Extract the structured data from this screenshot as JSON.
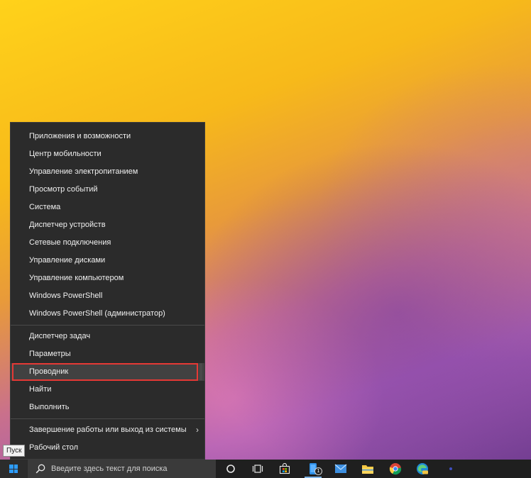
{
  "menu": {
    "group1": [
      {
        "label": "Приложения и возможности"
      },
      {
        "label": "Центр мобильности"
      },
      {
        "label": "Управление электропитанием"
      },
      {
        "label": "Просмотр событий"
      },
      {
        "label": "Система"
      },
      {
        "label": "Диспетчер устройств"
      },
      {
        "label": "Сетевые подключения"
      },
      {
        "label": "Управление дисками"
      },
      {
        "label": "Управление компьютером"
      },
      {
        "label": "Windows PowerShell"
      },
      {
        "label": "Windows PowerShell (администратор)"
      }
    ],
    "group2": [
      {
        "label": "Диспетчер задач"
      },
      {
        "label": "Параметры"
      },
      {
        "label": "Проводник"
      },
      {
        "label": "Найти"
      },
      {
        "label": "Выполнить"
      }
    ],
    "group3": [
      {
        "label": "Завершение работы или выход из системы"
      },
      {
        "label": "Рабочий стол"
      }
    ],
    "highlighted_item": "Проводник",
    "highlight_color": "#e53935"
  },
  "tooltip": {
    "text": "Пуск"
  },
  "taskbar": {
    "search_placeholder": "Введите здесь текст для поиска",
    "phone_badge": "1",
    "start_color": "#2d9cff"
  }
}
